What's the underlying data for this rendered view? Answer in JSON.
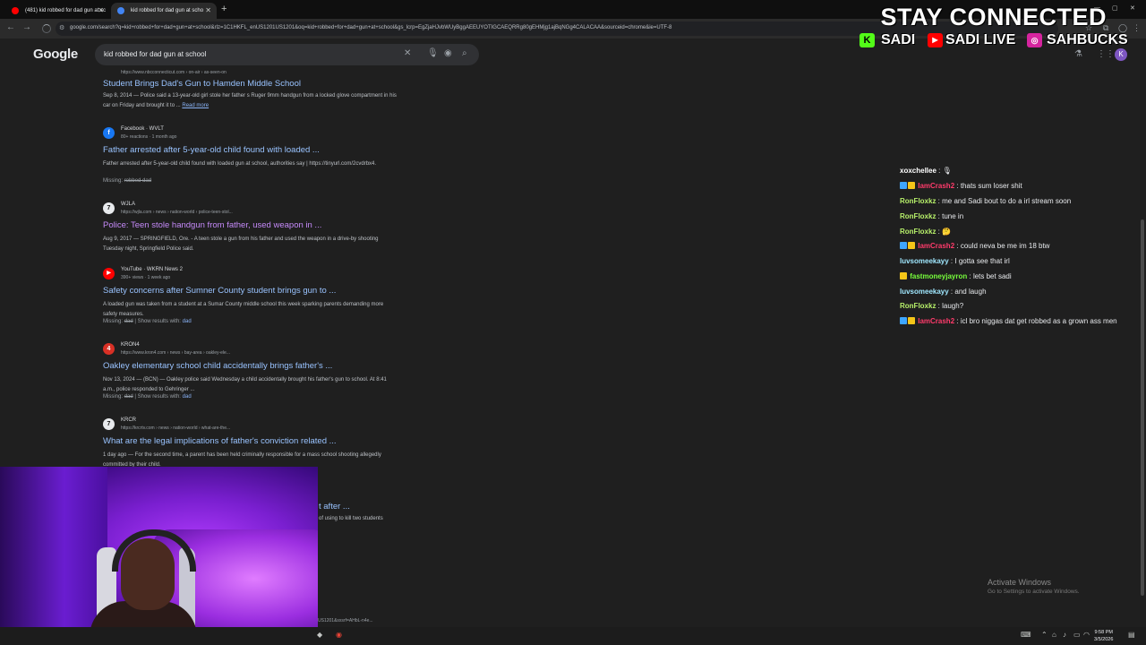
{
  "tabs": [
    {
      "label": "(481) kid robbed for dad gun at sc",
      "favicon_color": "#ff0000"
    },
    {
      "label": "kid robbed for dad gun at scho",
      "favicon_color": "#4285f4"
    }
  ],
  "toolbar": {
    "url": "google.com/search?q=kid+robbed+for+dad+gun+at+school&rlz=1C1HKFL_enUS1201US1201&oq=kid+robbed+for+dad+gun+at+school&gs_lcrp=EgZjaHJvbWUyBggAEEUYOTIGCAEQRRg80gEHMjg1ajBqNGg4CALACAA&sourceid=chrome&ie=UTF-8"
  },
  "google": {
    "logo": "Google",
    "query": "kid robbed for dad gun at school",
    "avatar_letter": "K"
  },
  "results": [
    {
      "site": "",
      "crumb": "https://www.nbcconnecticut.com › on-air › as-seen-on",
      "title": "Student Brings Dad's Gun to Hamden Middle School",
      "snippet_date": "Sep 8, 2014 — ",
      "snippet": "Police said a 13-year-old girl stole her father s Ruger 9mm handgun from a locked glove compartment in his car on Friday and brought it to ...",
      "read_more": "Read more",
      "icon": "N"
    },
    {
      "site": "Facebook · WVLT",
      "crumb": "80+ reactions · 1 month ago",
      "title": "Father arrested after 5-year-old child found with loaded ...",
      "snippet": "Father arrested after 5-year-old child found with loaded gun at school, authorities say | https://tinyurl.com/2cvdrbx4.",
      "missing_label": "Missing:",
      "missing_terms": "robbed dad",
      "icon": "f"
    },
    {
      "site": "WJLA",
      "crumb": "https://wjla.com › news › nation-world › police-teen-stol...",
      "title": "Police: Teen stole handgun from father, used weapon in ...",
      "snippet": "Aug 9, 2017 — SPRINGFIELD, Ore. - A teen stole a gun from his father and used the weapon in a drive-by shooting Tuesday night, Springfield Police said.",
      "icon": "7"
    },
    {
      "site": "YouTube · WKRN News 2",
      "crumb": "390+ views · 1 week ago",
      "title": "Safety concerns after Sumner County student brings gun to ...",
      "snippet": "A loaded gun was taken from a student at a Sumar County middle school this week sparking parents demanding more safety measures.",
      "missing_label": "Missing:",
      "missing_terms": "dad",
      "show_results": "Show results with:",
      "show_term": "dad",
      "icon": "▶"
    },
    {
      "site": "KRON4",
      "crumb": "https://www.kron4.com › news › bay-area › oakley-ele...",
      "title": "Oakley elementary school child accidentally brings father's ...",
      "snippet": "Nov 13, 2024 — (BCN) — Oakley police said Wednesday a child accidentally brought his father's gun to school. At 8:41 a.m., police responded to Gehringer ...",
      "missing_label": "Missing:",
      "missing_terms": "dad",
      "show_results": "Show results with:",
      "show_term": "dad",
      "icon": "4"
    },
    {
      "site": "KRCR",
      "crumb": "https://krcrtv.com › news › nation-world › what-are-the...",
      "title": "What are the legal implications of father's conviction related ...",
      "snippet": "1 day ago — For the second time, a parent has been held criminally responsible for a mass school shooting allegedly committed by their child.",
      "icon": "7"
    }
  ],
  "partial": {
    "title_tail": "t after ...",
    "snippet_tail": "of using to kill two students"
  },
  "statusbar": "US1201&sxsrf=AHbL-n4e...",
  "overlay": {
    "headline": "STAY CONNECTED",
    "kick": "SADI",
    "youtube": "SADI LIVE",
    "instagram": "SAHBUCKS"
  },
  "chat": [
    {
      "name": "xoxchellee",
      "color": "#ffffff",
      "message": "🎙",
      "badges": false
    },
    {
      "name": "IamCrash2",
      "color": "#ff3b6b",
      "message": "thats sum loser shit",
      "badges": true
    },
    {
      "name": "RonFloxkz",
      "color": "#b7f06a",
      "message": "me and Sadi bout to do a irl stream soon",
      "badges": false
    },
    {
      "name": "RonFloxkz",
      "color": "#b7f06a",
      "message": "tune in",
      "badges": false
    },
    {
      "name": "RonFloxkz",
      "color": "#b7f06a",
      "message": "🤔",
      "badges": false
    },
    {
      "name": "IamCrash2",
      "color": "#ff3b6b",
      "message": "could neva be me im 18 btw",
      "badges": true
    },
    {
      "name": "luvsomeekayy",
      "color": "#a0e8ff",
      "message": "I gotta see that irl",
      "badges": false
    },
    {
      "name": "fastmoneyjayron",
      "color": "#78ff3c",
      "message": "lets bet sadi",
      "badges": false
    },
    {
      "name": "luvsomeekayy",
      "color": "#a0e8ff",
      "message": "and laugh",
      "badges": false
    },
    {
      "name": "RonFloxkz",
      "color": "#b7f06a",
      "message": "laugh?",
      "badges": false
    },
    {
      "name": "IamCrash2",
      "color": "#ff3b6b",
      "message": "icl bro niggas dat get robbed as a grown ass men",
      "badges": true
    }
  ],
  "activate": {
    "line1": "Activate Windows",
    "line2": "Go to Settings to activate Windows."
  },
  "clock": {
    "time": "9:58 PM",
    "date": "3/5/2026"
  }
}
